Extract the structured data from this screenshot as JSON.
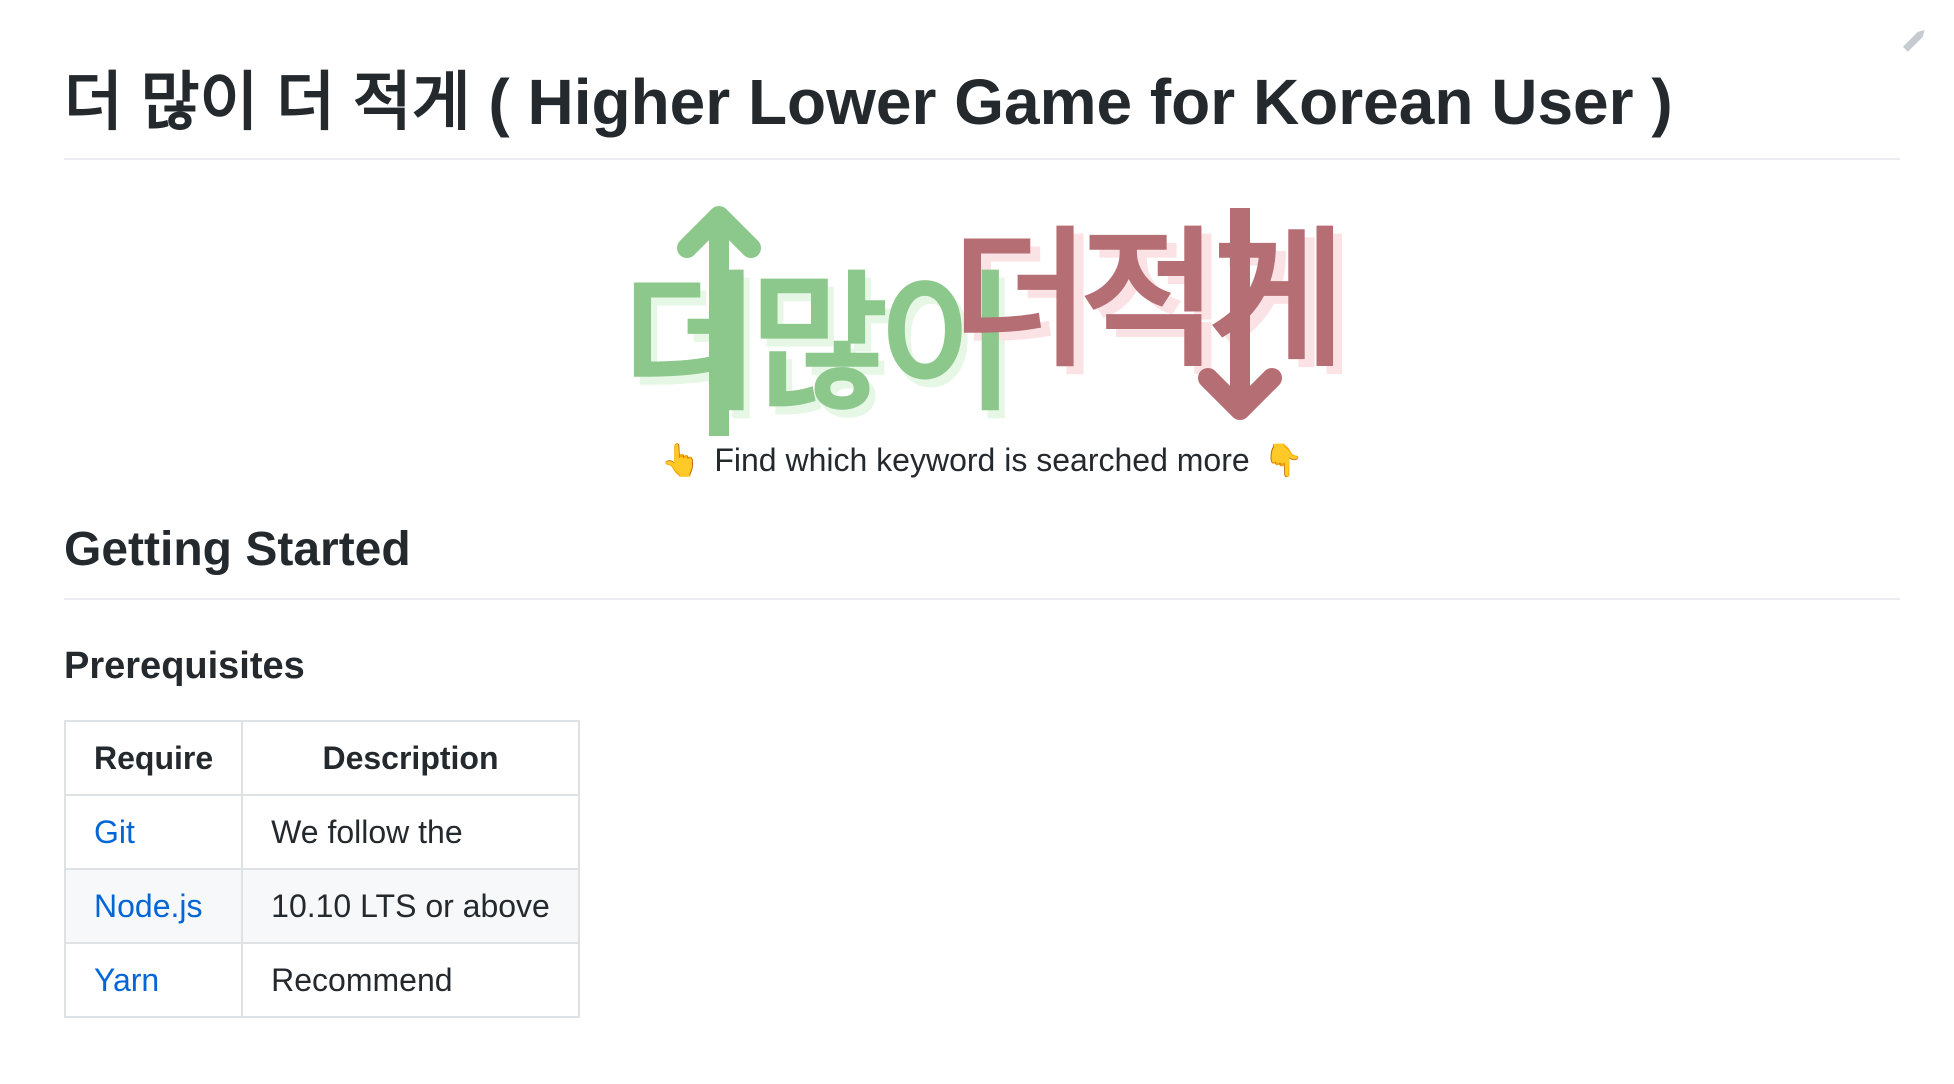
{
  "header": {
    "title": "더 많이 더 적게 ( Higher Lower Game for Korean User )"
  },
  "logo": {
    "word_more": "더많이",
    "word_less": "더적게",
    "color_more": "#8cc78b",
    "color_less": "#b56e73"
  },
  "tagline": {
    "left_emoji": "👆",
    "text": "Find which keyword is searched more",
    "right_emoji": "👇"
  },
  "getting_started": {
    "heading": "Getting Started",
    "prerequisites": {
      "heading": "Prerequisites",
      "columns": [
        "Require",
        "Description"
      ],
      "rows": [
        {
          "require": "Git",
          "description": "We follow the"
        },
        {
          "require": "Node.js",
          "description": "10.10 LTS or above"
        },
        {
          "require": "Yarn",
          "description": "Recommend"
        }
      ]
    }
  },
  "icons": {
    "edit": "pencil-icon"
  },
  "colors": {
    "link": "#0366d6",
    "text": "#24292e",
    "border": "#dfe2e5"
  }
}
